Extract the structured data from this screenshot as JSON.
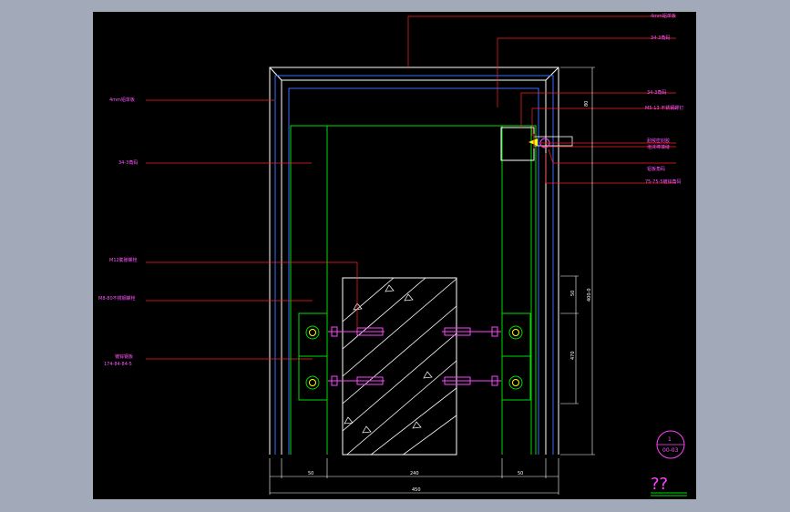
{
  "drawing": {
    "labels": [
      {
        "id": "top-right-label",
        "text": "4mm铝单板"
      },
      {
        "id": "top-right-label-2",
        "text": "34-3角码"
      },
      {
        "id": "left-top-label",
        "text": "4mm铝单板"
      },
      {
        "id": "right-label-1",
        "text": "34-3角码"
      },
      {
        "id": "right-label-2",
        "text": "M5-13 不锈钢螺钉"
      },
      {
        "id": "right-label-3",
        "text": "耐候密封胶"
      },
      {
        "id": "right-label-4",
        "text": "泡沫棒填缝"
      },
      {
        "id": "right-label-5",
        "text": "铝板角码"
      },
      {
        "id": "right-label-6",
        "text": "75-75-5镀锌角码"
      },
      {
        "id": "left-mid-label",
        "text": "34-3角码"
      },
      {
        "id": "left-lower-label-1",
        "text": "M12膨胀螺栓"
      },
      {
        "id": "left-lower-label-2",
        "text": "M8-80不锈钢螺栓"
      },
      {
        "id": "left-lower-label-3",
        "text": "镀锌钢板"
      },
      {
        "id": "left-lower-label-4",
        "text": "174-84-84-5"
      }
    ],
    "dimensions": {
      "bottom_left": "50",
      "bottom_center": "240",
      "bottom_right": "50",
      "bottom_total": "450",
      "right_top": "80",
      "right_mid": "50",
      "right_low": "470",
      "right_total": "400-0"
    },
    "bubble": {
      "number": "1",
      "ref": "00-03"
    },
    "corner_mark": "??"
  },
  "colors": {
    "background": "#000000",
    "frame": "#a2a9b8",
    "outline": "#ffffff",
    "steel": "#00dd00",
    "aluminium": "#3b6dff",
    "leader": "#ff2020",
    "text": "#ff55ff",
    "accent": "#ffff00"
  }
}
